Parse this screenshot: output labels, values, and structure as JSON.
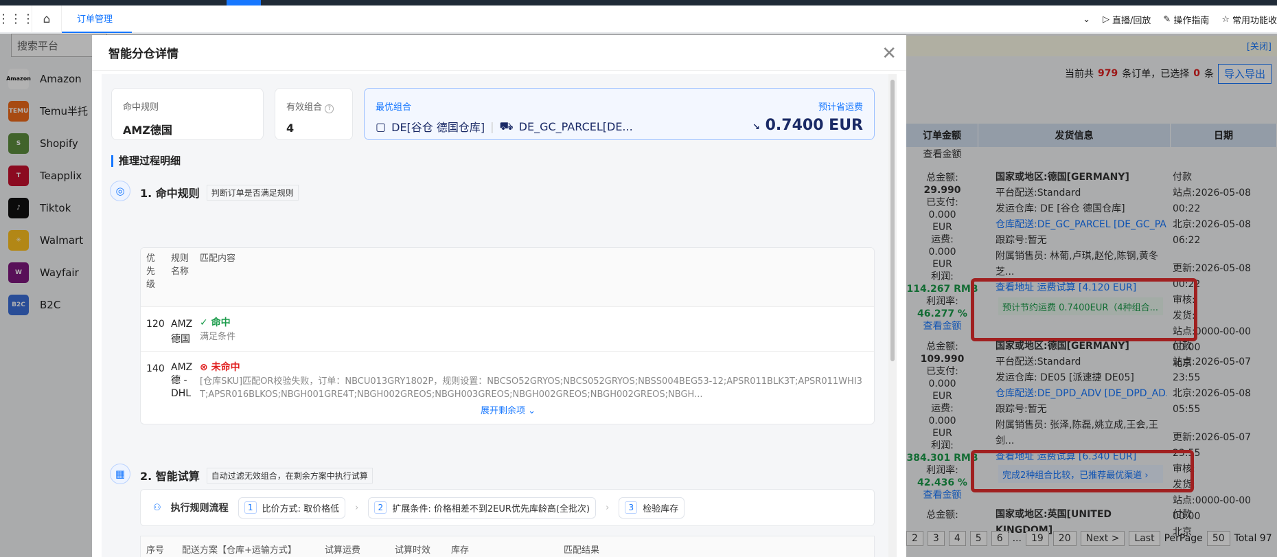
{
  "nav": {
    "tab": "订单管理",
    "right": [
      "直播/回放",
      "操作指南",
      "常用功能收"
    ]
  },
  "sidebar": {
    "search_placeholder": "搜索平台",
    "items": [
      {
        "label": "Amazon",
        "logo": "Amazon",
        "color": "#ffffff"
      },
      {
        "label": "Temu半托",
        "logo": "TEMU",
        "color": "#f06a1b"
      },
      {
        "label": "Shopify",
        "logo": "S",
        "color": "#5e8e3e"
      },
      {
        "label": "Teapplix",
        "logo": "T",
        "color": "#c8102e"
      },
      {
        "label": "Tiktok",
        "logo": "♪",
        "color": "#111111"
      },
      {
        "label": "Walmart",
        "logo": "✳",
        "color": "#ffc220"
      },
      {
        "label": "Wayfair",
        "logo": "W",
        "color": "#7f187f"
      },
      {
        "label": "B2C",
        "logo": "B2C",
        "color": "#3b6fd8"
      }
    ]
  },
  "background": {
    "notice_close": "[关闭]",
    "count_prefix": "当前共",
    "count_total": "979",
    "count_mid": "条订单，已选择",
    "count_selected": "0",
    "count_suffix": "条",
    "import_btn": "导入导出",
    "col_amount": "订单金额",
    "col_ship": "发货信息",
    "col_date": "日期",
    "view_amount": "查看金额",
    "order1": {
      "amount": [
        "总金额:",
        "29.990",
        "已支付:",
        "0.000",
        "EUR",
        "运费:",
        "0.000",
        "EUR",
        "利润:",
        "114.267 RMB",
        "利润率:",
        "46.277 %",
        "查看金额"
      ],
      "ship": [
        "国家或地区:德国[GERMANY]",
        "平台配送:Standard",
        "发运仓库: DE [谷仓 德国仓库]",
        "仓库配送:DE_GC_PARCEL [DE_GC_PA...",
        "跟踪号:暂无",
        "附属销售员: 林葡,卢琪,赵伦,陈钢,黄冬",
        "芝...",
        "查看地址  运费试算  [4.120 EUR]"
      ],
      "date": [
        "付款",
        "站点:2026-05-08 00:22",
        "北京:2026-05-08 06:22",
        "",
        "更新:2026-05-08 00:22",
        "审核:",
        "发货:",
        "站点:0000-00-00 00:00",
        "北京"
      ],
      "tip": "预计节约运费 0.7400EUR（4种组合..."
    },
    "order2": {
      "amount": [
        "总金额:",
        "109.990",
        "已支付:",
        "0.000",
        "EUR",
        "运费:",
        "0.000",
        "EUR",
        "利润:",
        "384.301 RMB",
        "利润率:",
        "42.436 %",
        "查看金额"
      ],
      "ship": [
        "国家或地区:德国[GERMANY]",
        "平台配送:Standard",
        "发运仓库: DE05 [派速捷 DE05]",
        "仓库配送:DE_DPD_ADV [DE_DPD_AD...",
        "跟踪号:暂无",
        "附属销售员: 张泽,陈磊,姚立成,王会,王",
        "剑...",
        "查看地址  运费试算  [6.340 EUR]"
      ],
      "date": [
        "付款",
        "站点:2026-05-07 23:55",
        "北京:2026-05-08 05:55",
        "",
        "更新:2026-05-07 23:55",
        "审核:",
        "发货:",
        "站点:0000-00-00 00:00",
        "北京"
      ],
      "tip": "完成2种组合比较，已推荐最优渠道"
    },
    "order3": {
      "amount": "总金额:",
      "country": "国家或地区:英国[UNITED KINGDOM]",
      "date": "付款"
    },
    "pager": [
      "2",
      "3",
      "4",
      "5",
      "6",
      "...",
      "19",
      "20",
      "Next >",
      "Last",
      "PerPage",
      "50",
      "Total 97"
    ]
  },
  "modal": {
    "title": "智能分仓详情",
    "hit_rule_label": "命中规则",
    "hit_rule_value": "AMZ德国",
    "valid_combo_label": "有效组合",
    "valid_combo_value": "4",
    "best_label": "最优组合",
    "best_warehouse": "DE[谷仓 德国仓库]",
    "best_channel": "DE_GC_PARCEL[DE...",
    "save_label": "预计省运费",
    "save_value": "0.7400 EUR",
    "process_title": "推理过程明细",
    "step1_title": "1. 命中规则",
    "step1_tag": "判断订单是否满足规则",
    "table_head": {
      "priority": "优先级",
      "name": "规则名称",
      "match": "匹配内容"
    },
    "rows": [
      {
        "priority": "120",
        "name": "AMZ德国",
        "status": "命中",
        "detail": "满足条件"
      },
      {
        "priority": "140",
        "name": "AMZ德 - DHL",
        "status": "未命中",
        "detail": "[仓库SKU]匹配OR校验失败，订单：NBCU013GRY1802P，规则设置：NBCSO52GRYOS;NBCS052GRYOS;NBSS004BEG53-12;APSR011BLK3T;APSR011WHI3T;APSR016BLKOS;NBGH001GRE4T;NBGH002GREOS;NBGH003GREOS;NBGH002GREOS;NBGH002GREOS;NBGH..."
      }
    ],
    "expand": "展开剩余项",
    "step2_title": "2. 智能试算",
    "step2_tag": "自动过滤无效组合，在剩余方案中执行试算",
    "flow_title": "执行规则流程",
    "flow_steps": [
      {
        "num": "1",
        "label": "比价方式: 取价格低"
      },
      {
        "num": "2",
        "label": "扩展条件: 价格相差不到2EUR优先库龄高(全批次)"
      },
      {
        "num": "3",
        "label": "检验库存"
      }
    ],
    "trial_head": [
      "序号",
      "配送方案【仓库+运输方式】",
      "试算运费",
      "试算时效",
      "库存",
      "匹配结果"
    ]
  }
}
